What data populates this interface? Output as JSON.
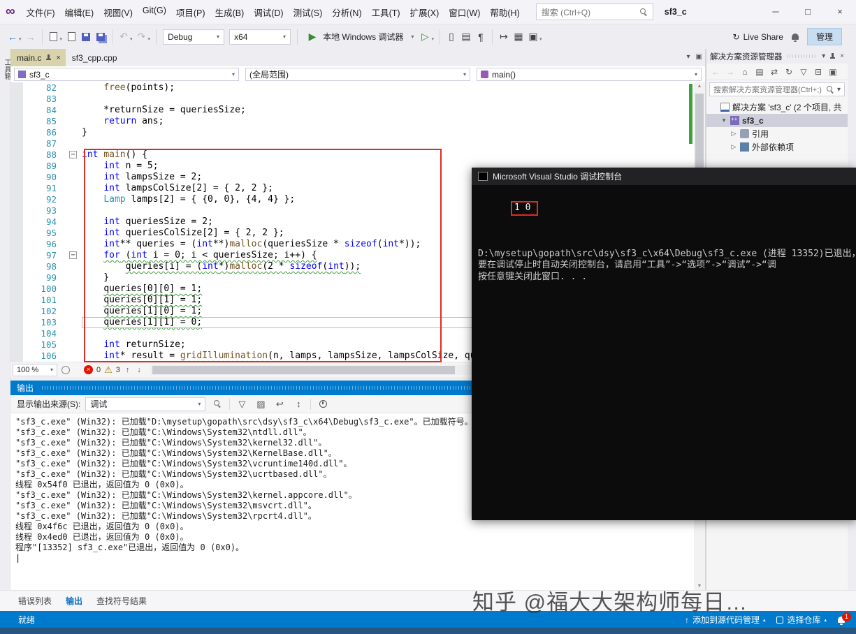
{
  "window": {
    "menus": [
      "文件(F)",
      "编辑(E)",
      "视图(V)",
      "Git(G)",
      "项目(P)",
      "生成(B)",
      "调试(D)",
      "测试(S)",
      "分析(N)",
      "工具(T)",
      "扩展(X)",
      "窗口(W)",
      "帮助(H)"
    ],
    "search_placeholder": "搜索 (Ctrl+Q)",
    "project_badge": "sf3_c"
  },
  "icons": {
    "vs-logo": "∞",
    "back": "←",
    "forward": "→",
    "undo": "↶",
    "redo": "↷",
    "caret": "▾",
    "caret-up": "▴",
    "play": "▶",
    "play-outline": "▷",
    "close": "×",
    "minimize": "─",
    "maximize": "□",
    "up": "↑",
    "down": "↓",
    "warning": "⚠",
    "home": "⌂",
    "refresh": "↻",
    "sync": "⇄",
    "live-share": "↻",
    "expanded": "▾",
    "collapsed": "▷",
    "collapse-all": "⊟",
    "filter": "▽",
    "list": "▤",
    "lines": "≡",
    "doc": "▯",
    "grid": "▦",
    "square": "▣",
    "clear": "▨",
    "wrap": "↩",
    "updown": "↕",
    "pilcrow": "¶",
    "mapsto": "↦",
    "scroll-up": "▲",
    "scroll-down": "▼"
  },
  "toolbar": {
    "configuration": "Debug",
    "platform": "x64",
    "run_label": "本地 Windows 调试器",
    "live_share_label": "Live Share",
    "manage_label": "管理"
  },
  "left_strip": {
    "toolbox_label": "工具箱"
  },
  "editor": {
    "tabs": [
      {
        "label": "main.c",
        "active": true,
        "pinned": true
      },
      {
        "label": "sf3_cpp.cpp",
        "active": false,
        "pinned": false
      }
    ],
    "navbar": {
      "project": "sf3_c",
      "scope": "(全局范围)",
      "member": "main()"
    },
    "zoom": "100 %",
    "error_count": "0",
    "warning_count": "3",
    "code_lines": [
      {
        "n": 82,
        "tokens": [
          [
            "p",
            "    "
          ],
          [
            "f",
            "free"
          ],
          [
            "p",
            "(points);"
          ]
        ]
      },
      {
        "n": 83,
        "tokens": []
      },
      {
        "n": 84,
        "tokens": [
          [
            "p",
            "    *returnSize = queriesSize;"
          ]
        ]
      },
      {
        "n": 85,
        "tokens": [
          [
            "p",
            "    "
          ],
          [
            "k",
            "return"
          ],
          [
            "p",
            " ans;"
          ]
        ]
      },
      {
        "n": 86,
        "tokens": [
          [
            "p",
            "}"
          ]
        ]
      },
      {
        "n": 87,
        "tokens": []
      },
      {
        "n": 88,
        "fold": true,
        "tokens": [
          [
            "k",
            "int"
          ],
          [
            "p",
            " "
          ],
          [
            "f",
            "main"
          ],
          [
            "p",
            "() {"
          ]
        ]
      },
      {
        "n": 89,
        "tokens": [
          [
            "p",
            "    "
          ],
          [
            "k",
            "int"
          ],
          [
            "p",
            " n = 5;"
          ]
        ]
      },
      {
        "n": 90,
        "tokens": [
          [
            "p",
            "    "
          ],
          [
            "k",
            "int"
          ],
          [
            "p",
            " lampsSize = 2;"
          ]
        ]
      },
      {
        "n": 91,
        "tokens": [
          [
            "p",
            "    "
          ],
          [
            "k",
            "int"
          ],
          [
            "p",
            " lampsColSize[2] = { 2, 2 };"
          ]
        ]
      },
      {
        "n": 92,
        "tokens": [
          [
            "p",
            "    "
          ],
          [
            "t",
            "Lamp"
          ],
          [
            "p",
            " lamps[2] = { {0, 0}, {4, 4} };"
          ]
        ]
      },
      {
        "n": 93,
        "tokens": []
      },
      {
        "n": 94,
        "tokens": [
          [
            "p",
            "    "
          ],
          [
            "k",
            "int"
          ],
          [
            "p",
            " queriesSize = 2;"
          ]
        ]
      },
      {
        "n": 95,
        "tokens": [
          [
            "p",
            "    "
          ],
          [
            "k",
            "int"
          ],
          [
            "p",
            " queriesColSize[2] = { 2, 2 };"
          ]
        ]
      },
      {
        "n": 96,
        "tokens": [
          [
            "p",
            "    "
          ],
          [
            "k",
            "int"
          ],
          [
            "p",
            "** queries = ("
          ],
          [
            "k",
            "int"
          ],
          [
            "p",
            "**)"
          ],
          [
            "f",
            "malloc"
          ],
          [
            "p",
            "(queriesSize * "
          ],
          [
            "k",
            "sizeof"
          ],
          [
            "p",
            "("
          ],
          [
            "k",
            "int"
          ],
          [
            "p",
            "*));"
          ]
        ]
      },
      {
        "n": 97,
        "fold": true,
        "tokens": [
          [
            "p",
            "    "
          ],
          [
            "k",
            "for",
            1
          ],
          [
            "p",
            " (",
            1
          ],
          [
            "k",
            "int",
            1
          ],
          [
            "p",
            " i = 0; i < queriesSize; i++) {",
            1
          ]
        ]
      },
      {
        "n": 98,
        "tokens": [
          [
            "p",
            "        "
          ],
          [
            "p",
            "queries[i] = (",
            1
          ],
          [
            "k",
            "int",
            1
          ],
          [
            "p",
            "*)",
            1
          ],
          [
            "f",
            "malloc",
            1
          ],
          [
            "p",
            "(2 * ",
            1
          ],
          [
            "k",
            "sizeof",
            1
          ],
          [
            "p",
            "(",
            1
          ],
          [
            "k",
            "int",
            1
          ],
          [
            "p",
            "));",
            1
          ]
        ]
      },
      {
        "n": 99,
        "tokens": [
          [
            "p",
            "    }"
          ]
        ]
      },
      {
        "n": 100,
        "tokens": [
          [
            "p",
            "    "
          ],
          [
            "p",
            "queries[0][0] = 1;",
            1
          ]
        ]
      },
      {
        "n": 101,
        "tokens": [
          [
            "p",
            "    "
          ],
          [
            "p",
            "queries[0][1] = 1;",
            1
          ]
        ]
      },
      {
        "n": 102,
        "tokens": [
          [
            "p",
            "    "
          ],
          [
            "p",
            "queries[1][0] = 1;",
            1
          ]
        ]
      },
      {
        "n": 103,
        "current": true,
        "tokens": [
          [
            "p",
            "    "
          ],
          [
            "p",
            "queries[1][1] = 0;",
            1
          ]
        ]
      },
      {
        "n": 104,
        "tokens": []
      },
      {
        "n": 105,
        "tokens": [
          [
            "p",
            "    "
          ],
          [
            "k",
            "int"
          ],
          [
            "p",
            " returnSize;"
          ]
        ]
      },
      {
        "n": 106,
        "tokens": [
          [
            "p",
            "    "
          ],
          [
            "k",
            "int"
          ],
          [
            "p",
            "* result = "
          ],
          [
            "f",
            "gridIllumination",
            1
          ],
          [
            "p",
            "(n, lamps, lampsSize, lampsColSize, queries, "
          ]
        ]
      }
    ]
  },
  "console": {
    "title": "Microsoft Visual Studio 调试控制台",
    "output_value": "1 0",
    "lines": [
      "D:\\mysetup\\gopath\\src\\dsy\\sf3_c\\x64\\Debug\\sf3_c.exe (进程 13352)已退出，",
      "要在调试停止时自动关闭控制台，请启用“工具”->“选项”->“调试”->“调",
      "按任意键关闭此窗口. . ."
    ]
  },
  "output_panel": {
    "title": "输出",
    "source_label": "显示输出来源(S):",
    "source_value": "调试",
    "lines": [
      "\"sf3_c.exe\" (Win32): 已加载\"D:\\mysetup\\gopath\\src\\dsy\\sf3_c\\x64\\Debug\\sf3_c.exe\"。已加载符号。",
      "\"sf3_c.exe\" (Win32): 已加载\"C:\\Windows\\System32\\ntdll.dll\"。",
      "\"sf3_c.exe\" (Win32): 已加载\"C:\\Windows\\System32\\kernel32.dll\"。",
      "\"sf3_c.exe\" (Win32): 已加载\"C:\\Windows\\System32\\KernelBase.dll\"。",
      "\"sf3_c.exe\" (Win32): 已加载\"C:\\Windows\\System32\\vcruntime140d.dll\"。",
      "\"sf3_c.exe\" (Win32): 已加载\"C:\\Windows\\System32\\ucrtbased.dll\"。",
      "线程 0x54f0 已退出，返回值为 0 (0x0)。",
      "\"sf3_c.exe\" (Win32): 已加载\"C:\\Windows\\System32\\kernel.appcore.dll\"。",
      "\"sf3_c.exe\" (Win32): 已加载\"C:\\Windows\\System32\\msvcrt.dll\"。",
      "\"sf3_c.exe\" (Win32): 已加载\"C:\\Windows\\System32\\rpcrt4.dll\"。",
      "线程 0x4f6c 已退出，返回值为 0 (0x0)。",
      "线程 0x4ed0 已退出，返回值为 0 (0x0)。",
      "程序\"[13352] sf3_c.exe\"已退出，返回值为 0 (0x0)。"
    ]
  },
  "panel_tabs": [
    {
      "label": "错误列表",
      "active": false
    },
    {
      "label": "输出",
      "active": true
    },
    {
      "label": "查找符号结果",
      "active": false
    }
  ],
  "solution_explorer": {
    "title": "解决方案资源管理器",
    "search_placeholder": "搜索解决方案资源管理器(Ctrl+;)",
    "tree": [
      {
        "label": "解决方案 'sf3_c' (2 个项目, 共",
        "icon": "solution",
        "arrow": "",
        "level": 0,
        "selected": false,
        "bold": false
      },
      {
        "label": "sf3_c",
        "icon": "cpp-project",
        "arrow": "expanded",
        "level": 1,
        "selected": true,
        "bold": true
      },
      {
        "label": "引用",
        "icon": "references",
        "arrow": "collapsed",
        "level": 2,
        "selected": false,
        "bold": false
      },
      {
        "label": "外部依赖项",
        "icon": "dependencies",
        "arrow": "collapsed",
        "level": 2,
        "selected": false,
        "bold": false
      }
    ]
  },
  "status_bar": {
    "ready": "就绪",
    "add_source_control": "添加到源代码管理",
    "select_repo": "选择仓库",
    "notification_count": "1"
  },
  "watermark": "知乎 @福大大架构师每日…"
}
